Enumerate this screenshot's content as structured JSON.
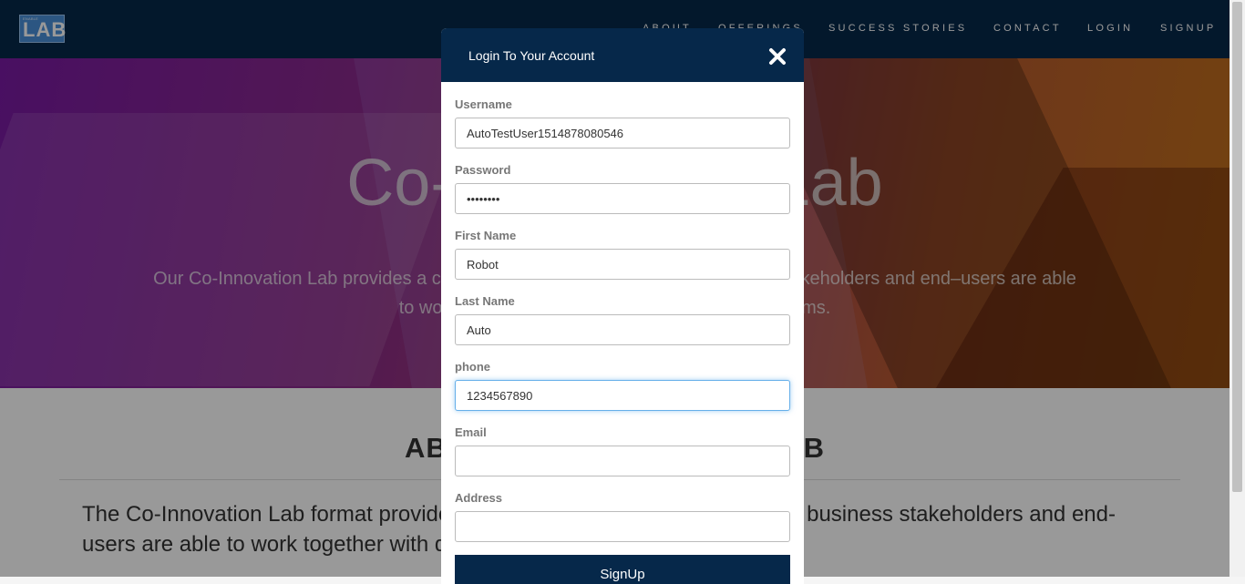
{
  "navbar": {
    "logo": {
      "top_text": "ENABLE",
      "main_text": "LAB"
    },
    "items": [
      "ABOUT",
      "OFFERINGS",
      "SUCCESS STORIES",
      "CONTACT",
      "LOGIN",
      "SIGNUP"
    ]
  },
  "hero": {
    "title": "Co-Innovation Lab",
    "description": "Our Co-Innovation Lab provides a collaborative environment where business stakeholders and end–users are able to work together with design and development teams."
  },
  "about": {
    "title": "ABOUT CO-INNOVATION LAB",
    "text": "The Co-Innovation Lab format provides a collaborative environment where business stakeholders and end-users are able to work together with design team"
  },
  "modal": {
    "title": "Login To Your Account",
    "close_icon": "close-x",
    "fields": {
      "username": {
        "label": "Username",
        "value": "AutoTestUser1514878080546"
      },
      "password": {
        "label": "Password",
        "value": "password"
      },
      "first_name": {
        "label": "First Name",
        "value": "Robot"
      },
      "last_name": {
        "label": "Last Name",
        "value": "Auto"
      },
      "phone": {
        "label": "phone",
        "value": "1234567890"
      },
      "email": {
        "label": "Email",
        "value": ""
      },
      "address": {
        "label": "Address",
        "value": ""
      }
    },
    "submit_label": "SignUp"
  },
  "colors": {
    "navy": "#06284a",
    "focus": "#66afe9"
  }
}
